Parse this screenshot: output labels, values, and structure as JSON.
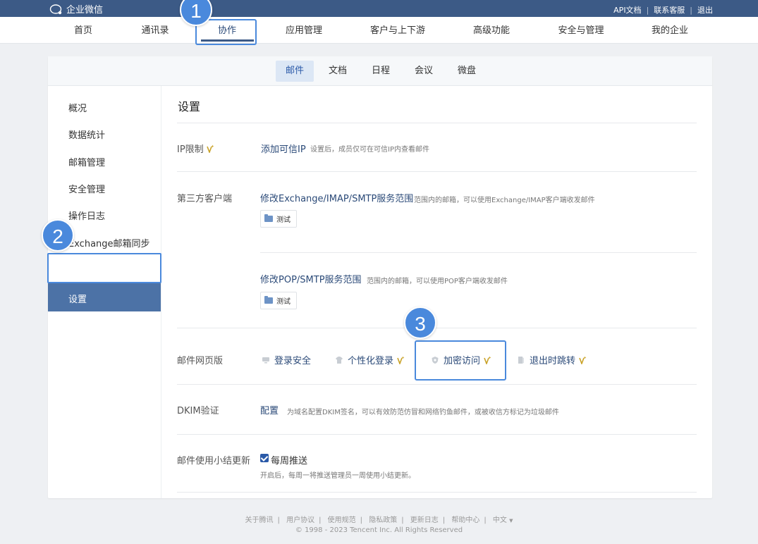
{
  "app": {
    "name": "企业微信"
  },
  "top_links": [
    "API文档",
    "联系客服",
    "退出"
  ],
  "nav": {
    "items": [
      "首页",
      "通讯录",
      "协作",
      "应用管理",
      "客户与上下游",
      "高级功能",
      "安全与管理",
      "我的企业"
    ],
    "active": "协作"
  },
  "subtabs": {
    "items": [
      "邮件",
      "文档",
      "日程",
      "会议",
      "微盘"
    ],
    "active": "邮件"
  },
  "sidebar": {
    "items": [
      "概况",
      "数据统计",
      "邮箱管理",
      "安全管理",
      "操作日志",
      "Exchange邮箱同步",
      "设置"
    ],
    "active": "设置"
  },
  "main": {
    "title": "设置",
    "ip_limit": {
      "label": "IP限制",
      "link": "添加可信IP",
      "desc": "设置后，成员仅可在可信IP内查看邮件"
    },
    "third_party": {
      "label": "第三方客户端",
      "exchange_link": "修改Exchange/IMAP/SMTP服务范围",
      "exchange_desc": "范围内的邮箱，可以使用Exchange/IMAP客户端收发邮件",
      "exchange_tag": "测试",
      "pop_link": "修改POP/SMTP服务范围",
      "pop_desc": "范围内的邮箱，可以使用POP客户端收发邮件",
      "pop_tag": "测试"
    },
    "web_mail": {
      "label": "邮件网页版",
      "items": [
        "登录安全",
        "个性化登录",
        "加密访问",
        "退出时跳转"
      ]
    },
    "dkim": {
      "label": "DKIM验证",
      "link": "配置",
      "desc": "为域名配置DKIM签名，可以有效防范仿冒和网络钓鱼邮件，或被收信方标记为垃圾邮件"
    },
    "summary": {
      "label": "邮件使用小结更新",
      "checkbox_label": "每周推送",
      "checked": true,
      "desc": "开启后，每周一将推送管理员一周使用小结更新。"
    }
  },
  "footer": {
    "links": [
      "关于腾讯",
      "用户协议",
      "使用规范",
      "隐私政策",
      "更新日志",
      "帮助中心",
      "中文"
    ],
    "copyright": "© 1998 - 2023 Tencent Inc. All Rights Reserved"
  },
  "badges": [
    "1",
    "2",
    "3"
  ],
  "colors": {
    "topbar": "#3c5a86",
    "accent": "#2b4a78",
    "sidebar_active": "#4c72a6",
    "highlight": "#4a89dc",
    "sparkle": "#c9a227"
  }
}
